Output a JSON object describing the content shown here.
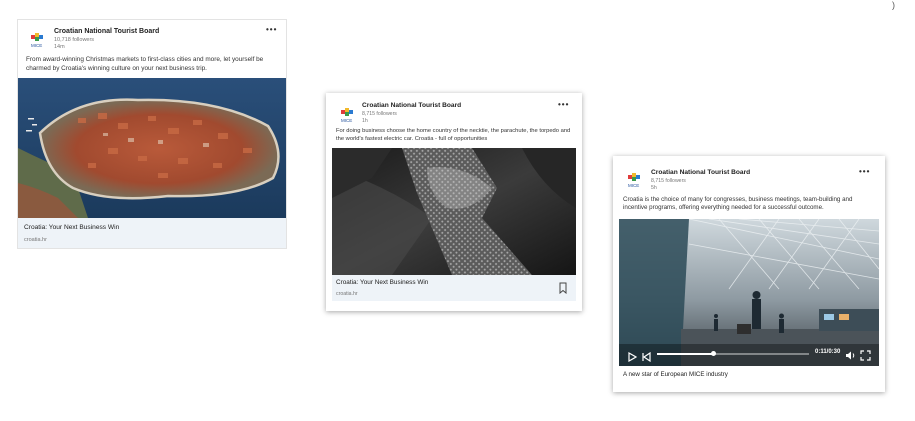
{
  "corner_mark": ")",
  "posts": [
    {
      "org_name": "Croatian National Tourist Board",
      "followers": "10,718 followers",
      "time": "14m",
      "more_icon": "•••",
      "text": "From award-winning Christmas markets to first-class cities and more, let yourself be charmed by Croatia's winning culture on your next business trip.",
      "image": "aerial-old-town-dubrovnik",
      "link_title": "Croatia: Your Next Business Win",
      "link_domain": "croatia.hr"
    },
    {
      "org_name": "Croatian National Tourist Board",
      "followers": "8,715 followers",
      "time": "1h",
      "more_icon": "•••",
      "text": "For doing business choose the home country of the necktie, the parachute, the torpedo and the world's fastest electric car. Croatia - full of opportunities",
      "image": "necktie-closeup",
      "link_title": "Croatia: Your Next Business Win",
      "link_domain": "croatia.hr",
      "bookmark_icon": "bookmark-icon"
    },
    {
      "org_name": "Croatian National Tourist Board",
      "followers": "8,715 followers",
      "time": "5h",
      "more_icon": "•••",
      "text": "Croatia is the choice of many for congresses, business meetings, team-building and incentive programs, offering everything needed for a successful outcome.",
      "image": "airport-terminal-video",
      "video_time": "0:11/0:30",
      "video_progress": 0.37,
      "caption": "A new star of European MICE industry"
    }
  ]
}
